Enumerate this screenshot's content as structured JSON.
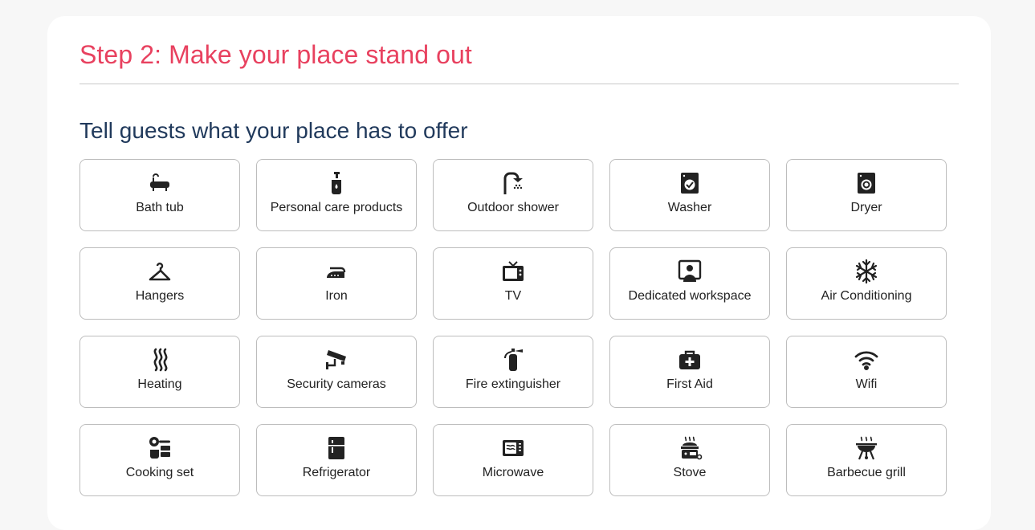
{
  "step": {
    "title": "Step 2: Make your place stand out"
  },
  "section": {
    "title": "Tell guests what your place has to offer"
  },
  "amenities": [
    {
      "label": "Bath tub",
      "icon": "bathtub-icon"
    },
    {
      "label": "Personal care products",
      "icon": "soap-bottle-icon"
    },
    {
      "label": "Outdoor shower",
      "icon": "shower-icon"
    },
    {
      "label": "Washer",
      "icon": "washer-icon"
    },
    {
      "label": "Dryer",
      "icon": "dryer-icon"
    },
    {
      "label": "Hangers",
      "icon": "hanger-icon"
    },
    {
      "label": "Iron",
      "icon": "iron-icon"
    },
    {
      "label": "TV",
      "icon": "tv-icon"
    },
    {
      "label": "Dedicated workspace",
      "icon": "workspace-icon"
    },
    {
      "label": "Air Conditioning",
      "icon": "snowflake-icon"
    },
    {
      "label": "Heating",
      "icon": "heat-waves-icon"
    },
    {
      "label": "Security cameras",
      "icon": "security-camera-icon"
    },
    {
      "label": "Fire extinguisher",
      "icon": "fire-extinguisher-icon"
    },
    {
      "label": "First Aid",
      "icon": "first-aid-kit-icon"
    },
    {
      "label": "Wifi",
      "icon": "wifi-icon"
    },
    {
      "label": "Cooking set",
      "icon": "cooking-set-icon"
    },
    {
      "label": "Refrigerator",
      "icon": "refrigerator-icon"
    },
    {
      "label": "Microwave",
      "icon": "microwave-icon"
    },
    {
      "label": "Stove",
      "icon": "stove-icon"
    },
    {
      "label": "Barbecue grill",
      "icon": "barbecue-grill-icon"
    }
  ],
  "colors": {
    "title": "#e8415f",
    "heading": "#213a5c",
    "border": "#bdbdbd",
    "icon": "#222222"
  }
}
